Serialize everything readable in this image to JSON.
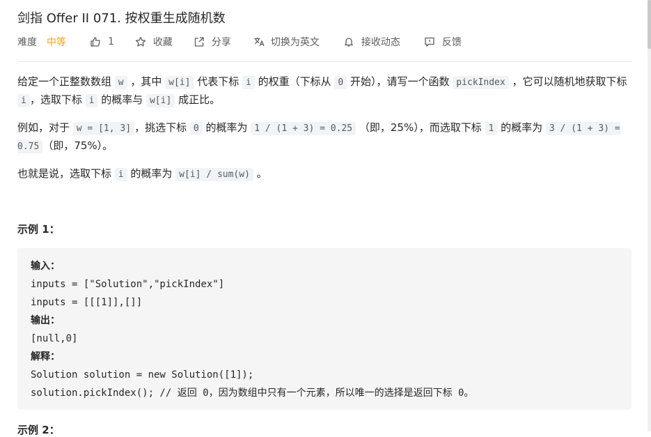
{
  "problem": {
    "title": "剑指 Offer II 071. 按权重生成随机数"
  },
  "meta": {
    "difficulty_label": "难度",
    "difficulty_value": "中等",
    "likes_count": "1",
    "favorite_label": "收藏",
    "share_label": "分享",
    "switch_lang_label": "切换为英文",
    "subscribe_label": "接收动态",
    "feedback_label": "反馈"
  },
  "description": {
    "p1": {
      "t1": "给定一个正整数数组 ",
      "c1": "w",
      "t2": " ，其中 ",
      "c2": "w[i]",
      "t3": " 代表下标 ",
      "c3": "i",
      "t4": " 的权重（下标从 ",
      "c4": "0",
      "t5": " 开始），请写一个函数 ",
      "c5": "pickIndex",
      "t6": " ，它可以随机地获取下标 ",
      "c6": "i",
      "t7": "，选取下标 ",
      "c7": "i",
      "t8": " 的概率与 ",
      "c8": "w[i]",
      "t9": " 成正比。"
    },
    "p2": {
      "t1": "例如，对于 ",
      "c1": "w = [1, 3]",
      "t2": "，挑选下标 ",
      "c2": "0",
      "t3": " 的概率为 ",
      "c3": "1 / (1 + 3)  = 0.25",
      "t4": " （即，25%），而选取下标 ",
      "c4": "1",
      "t5": " 的概率为 ",
      "c5": "3 / (1 + 3)  = 0.75",
      "t6": "（即，75%）。"
    },
    "p3": {
      "t1": "也就是说，选取下标 ",
      "c1": "i",
      "t2": " 的概率为 ",
      "c2": "w[i] / sum(w)",
      "t3": " 。"
    }
  },
  "example1": {
    "title": "示例 1：",
    "input_label": "输入：",
    "input_line1": "inputs = [\"Solution\",\"pickIndex\"]",
    "input_line2": "inputs = [[[1]],[]]",
    "output_label": "输出：",
    "output_value": "[null,0]",
    "explain_label": "解释：",
    "explain_line1": "Solution solution = new Solution([1]);",
    "explain_line2": "solution.pickIndex(); // 返回 0，因为数组中只有一个元素，所以唯一的选择是返回下标 0。"
  },
  "example2": {
    "title": "示例 2："
  }
}
